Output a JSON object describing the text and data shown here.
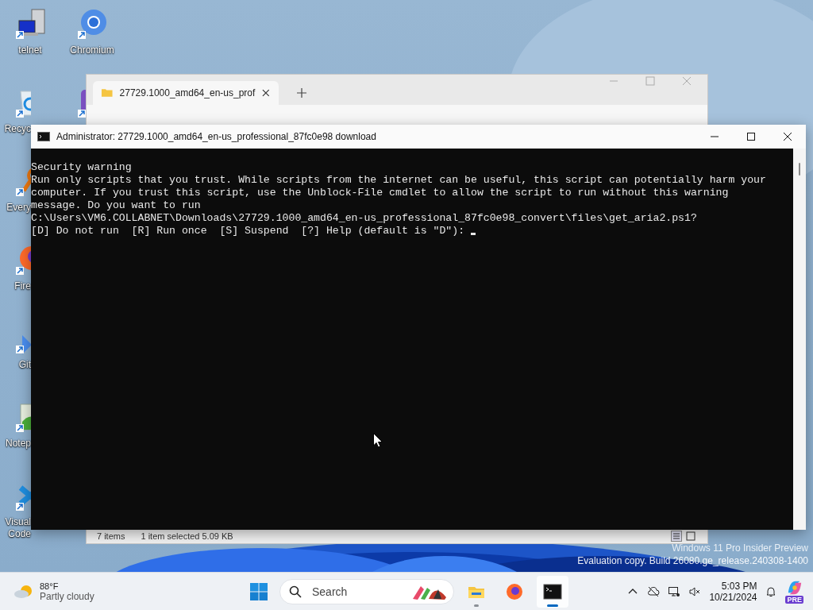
{
  "desktop_icons": [
    {
      "kind": "computer",
      "labels": [
        "telnet"
      ]
    },
    {
      "kind": "recycle-bin",
      "labels": [
        "Recyc"
      ]
    },
    {
      "kind": "magnifier",
      "labels": [
        "Every"
      ]
    },
    {
      "kind": "firefox",
      "labels": [
        "Fire"
      ]
    },
    {
      "kind": "git",
      "labels": [
        "Git"
      ]
    },
    {
      "kind": "notepad",
      "labels": [
        "Notep"
      ]
    },
    {
      "kind": "vscode",
      "labels": [
        "Visual",
        "Code"
      ]
    },
    {
      "kind": "chromium",
      "labels": [
        "Chromium"
      ]
    },
    {
      "kind": "purple-app"
    }
  ],
  "explorer": {
    "tab_title": "27729.1000_amd64_en-us_prof",
    "status_items": "7 items",
    "status_selection": "1 item selected  5.09 KB"
  },
  "console": {
    "title": "Administrator:  27729.1000_amd64_en-us_professional_87fc0e98 download",
    "lines": [
      "Security warning",
      "Run only scripts that you trust. While scripts from the internet can be useful, this script can potentially harm your",
      "computer. If you trust this script, use the Unblock-File cmdlet to allow the script to run without this warning",
      "message. Do you want to run",
      "C:\\Users\\VM6.COLLABNET\\Downloads\\27729.1000_amd64_en-us_professional_87fc0e98_convert\\files\\get_aria2.ps1?",
      "[D] Do not run  [R] Run once  [S] Suspend  [?] Help (default is \"D\"):"
    ]
  },
  "watermark": [
    "Windows 11 Pro Insider Preview",
    "Evaluation copy. Build 26080.ge_release.240308-1400"
  ],
  "taskbar": {
    "weather": {
      "temperature": "88°F",
      "condition": "Partly cloudy"
    },
    "search": {
      "placeholder": "Search"
    },
    "apps": [
      {
        "kind": "explorer",
        "running": true,
        "selected": false
      },
      {
        "kind": "firefox",
        "running": false,
        "selected": false
      },
      {
        "kind": "terminal",
        "running": true,
        "selected": true
      }
    ],
    "clock": {
      "time": "5:03 PM",
      "date": "10/21/2024"
    },
    "copilot_badge": "PRE"
  }
}
